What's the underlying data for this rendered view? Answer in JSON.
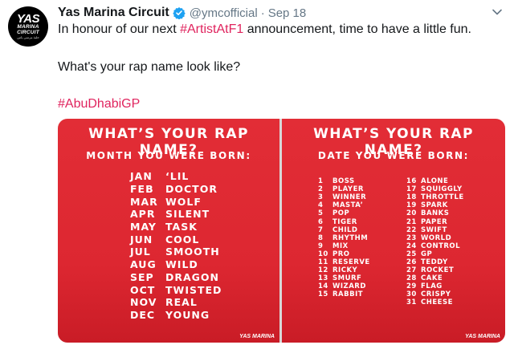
{
  "tweet": {
    "account_name": "Yas Marina Circuit",
    "handle": "@ymcofficial",
    "separator": "·",
    "date": "Sep 18",
    "avatar": {
      "line1": "YAS",
      "line2": "MARINA",
      "line3": "CIRCUIT",
      "line4": "حلبة مرسى ياس",
      "icon": "yas-marina-logo"
    },
    "text": {
      "line1_prefix": "In honour of our next ",
      "line1_hashtag": "#ArtistAtF1",
      "line1_suffix": " announcement, time to have a little fun.",
      "line2": "What's your rap name look like?",
      "line3_hashtag": "#AbuDhabiGP"
    },
    "colors": {
      "hashtag": "#e0245e",
      "panel_red": "#e22d36",
      "verified": "#1da1f2"
    }
  },
  "media": {
    "left_panel": {
      "title": "WHAT’S YOUR RAP NAME?",
      "subtitle": "MONTH YOU WERE BORN:",
      "months": [
        {
          "m": "JAN",
          "w": "‘LIL"
        },
        {
          "m": "FEB",
          "w": "DOCTOR"
        },
        {
          "m": "MAR",
          "w": "WOLF"
        },
        {
          "m": "APR",
          "w": "SILENT"
        },
        {
          "m": "MAY",
          "w": "TASK"
        },
        {
          "m": "JUN",
          "w": "COOL"
        },
        {
          "m": "JUL",
          "w": "SMOOTH"
        },
        {
          "m": "AUG",
          "w": "WILD"
        },
        {
          "m": "SEP",
          "w": "DRAGON"
        },
        {
          "m": "OCT",
          "w": "TWISTED"
        },
        {
          "m": "NOV",
          "w": "REAL"
        },
        {
          "m": "DEC",
          "w": "YOUNG"
        }
      ],
      "corner_logo": "YAS MARINA"
    },
    "right_panel": {
      "title": "WHAT’S YOUR RAP NAME?",
      "subtitle": "DATE YOU WERE BORN:",
      "dates_col1": [
        {
          "n": "1",
          "w": "BOSS"
        },
        {
          "n": "2",
          "w": "PLAYER"
        },
        {
          "n": "3",
          "w": "WINNER"
        },
        {
          "n": "4",
          "w": "MASTA’"
        },
        {
          "n": "5",
          "w": "POP"
        },
        {
          "n": "6",
          "w": "TIGER"
        },
        {
          "n": "7",
          "w": "CHILD"
        },
        {
          "n": "8",
          "w": "RHYTHM"
        },
        {
          "n": "9",
          "w": "MIX"
        },
        {
          "n": "10",
          "w": "PRO"
        },
        {
          "n": "11",
          "w": "RESERVE"
        },
        {
          "n": "12",
          "w": "RICKY"
        },
        {
          "n": "13",
          "w": "SMURF"
        },
        {
          "n": "14",
          "w": "WIZARD"
        },
        {
          "n": "15",
          "w": "RABBIT"
        }
      ],
      "dates_col2": [
        {
          "n": "16",
          "w": "ALONE"
        },
        {
          "n": "17",
          "w": "SQUIGGLY"
        },
        {
          "n": "18",
          "w": "THROTTLE"
        },
        {
          "n": "19",
          "w": "SPARK"
        },
        {
          "n": "20",
          "w": "BANKS"
        },
        {
          "n": "21",
          "w": "PAPER"
        },
        {
          "n": "22",
          "w": "SWIFT"
        },
        {
          "n": "23",
          "w": "WORLD"
        },
        {
          "n": "24",
          "w": "CONTROL"
        },
        {
          "n": "25",
          "w": "GP"
        },
        {
          "n": "26",
          "w": "TEDDY"
        },
        {
          "n": "27",
          "w": "ROCKET"
        },
        {
          "n": "28",
          "w": "CAKE"
        },
        {
          "n": "29",
          "w": "FLAG"
        },
        {
          "n": "30",
          "w": "CRISPY"
        },
        {
          "n": "31",
          "w": "CHEESE"
        }
      ],
      "corner_logo": "YAS MARINA"
    }
  }
}
